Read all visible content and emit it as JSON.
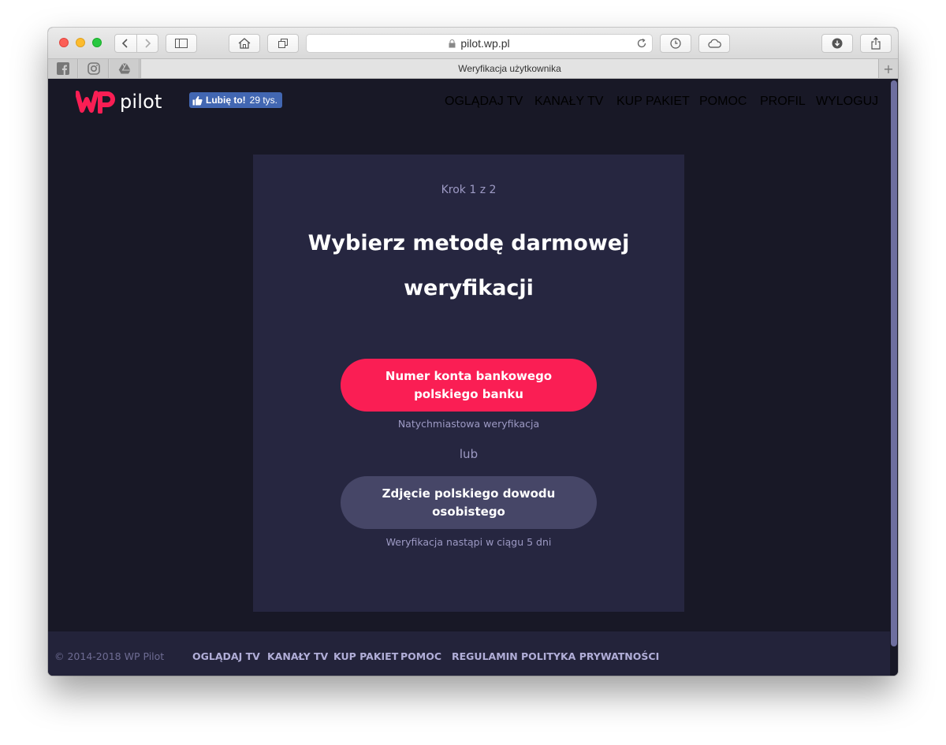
{
  "browser": {
    "url": "pilot.wp.pl",
    "tab_title": "Weryfikacja użytkownika",
    "pinned_tabs": [
      "facebook-icon",
      "instagram-icon",
      "google-drive-icon"
    ]
  },
  "header": {
    "logo_mark": "WP",
    "logo_text": "pilot",
    "fb_like": {
      "label": "Lubię to!",
      "count": "29 tys."
    },
    "nav": [
      {
        "label": "OGLĄDAJ TV"
      },
      {
        "label": "KANAŁY TV"
      },
      {
        "label": "KUP PAKIET"
      },
      {
        "label": "POMOC"
      },
      {
        "label": "PROFIL"
      },
      {
        "label": "WYLOGUJ"
      }
    ]
  },
  "main": {
    "step": "Krok 1 z 2",
    "title": "Wybierz metodę darmowej weryfikacji",
    "options": [
      {
        "label": "Numer konta bankowego polskiego banku",
        "note": "Natychmiastowa weryfikacja"
      },
      {
        "label": "Zdjęcie polskiego dowodu osobistego",
        "note": "Weryfikacja nastąpi w ciągu 5 dni"
      }
    ],
    "or_label": "lub"
  },
  "footer": {
    "copyright": "© 2014-2018 WP Pilot",
    "links": [
      {
        "label": "OGLĄDAJ TV"
      },
      {
        "label": "KANAŁY TV"
      },
      {
        "label": "KUP PAKIET"
      },
      {
        "label": "POMOC"
      },
      {
        "label": "REGULAMIN"
      },
      {
        "label": "POLITYKA PRYWATNOŚCI"
      }
    ]
  },
  "colors": {
    "accent": "#fa1e54",
    "background": "#181826",
    "card": "#262640",
    "nav_text": "#a9a5d6"
  }
}
